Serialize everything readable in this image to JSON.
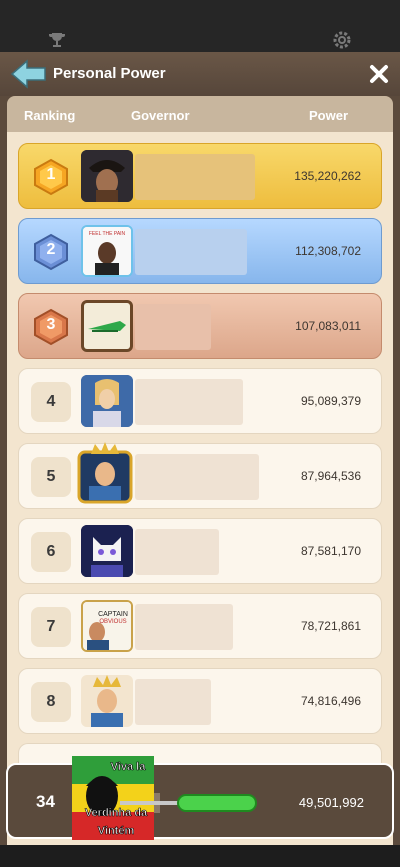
{
  "header": {
    "title": "Personal Power"
  },
  "columns": {
    "ranking": "Ranking",
    "governor": "Governor",
    "power": "Power"
  },
  "rows": [
    {
      "rank": "1",
      "power": "135,220,262"
    },
    {
      "rank": "2",
      "power": "112,308,702"
    },
    {
      "rank": "3",
      "power": "107,083,011"
    },
    {
      "rank": "4",
      "power": "95,089,379"
    },
    {
      "rank": "5",
      "power": "87,964,536"
    },
    {
      "rank": "6",
      "power": "87,581,170"
    },
    {
      "rank": "7",
      "power": "78,721,861"
    },
    {
      "rank": "8",
      "power": "74,816,496"
    }
  ],
  "self": {
    "rank": "34",
    "power": "49,501,992",
    "avatar_text": [
      "Viva la",
      "Verdinha da",
      "Vintém"
    ]
  },
  "avatar_texts": {
    "row2": "FEEL THE PAIN",
    "row7_line1": "CAPTAIN",
    "row7_line2": "OBVIOUS"
  },
  "colors": {
    "gold": "#eebd3e",
    "silver_blue": "#87b6ec",
    "bronze": "#dca68a",
    "panel": "#5b4a3c"
  }
}
